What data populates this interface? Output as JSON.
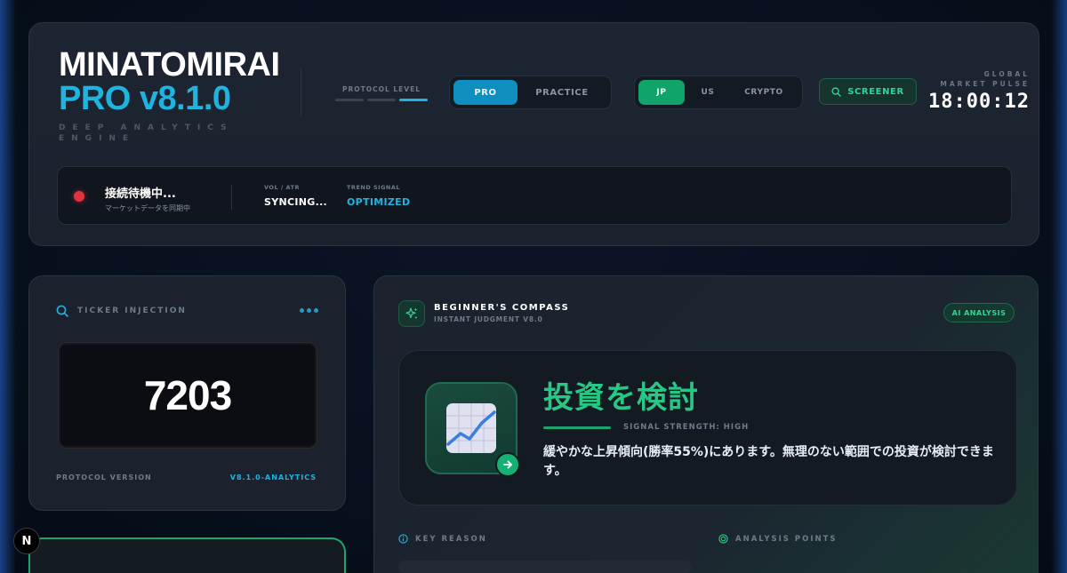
{
  "brand": {
    "title": "MINATOMIRAI",
    "version": "PRO v8.1.0",
    "subtitle": "DEEP ANALYTICS ENGINE"
  },
  "protocol_level": {
    "label": "PROTOCOL LEVEL",
    "level": 3,
    "max": 3
  },
  "mode_toggle": {
    "options": [
      "PRO",
      "PRACTICE"
    ],
    "selected": "PRO"
  },
  "market_toggle": {
    "options": [
      "JP",
      "US",
      "CRYPTO"
    ],
    "selected": "JP"
  },
  "screener": {
    "label": "SCREENER"
  },
  "pulse": {
    "label": "GLOBAL MARKET PULSE",
    "time": "18:00:12"
  },
  "status": {
    "title": "接続待機中...",
    "subtitle": "マーケットデータを同期中",
    "indicator_color": "#e0333d",
    "vol_label": "VOL / ATR",
    "vol_value": "SYNCING...",
    "trend_label": "TREND SIGNAL",
    "trend_value": "OPTIMIZED"
  },
  "ticker": {
    "label": "TICKER INJECTION",
    "value": "7203",
    "footer_label": "PROTOCOL VERSION",
    "footer_value": "V8.1.0-ANALYTICS"
  },
  "compass": {
    "title": "BEGINNER'S COMPASS",
    "subtitle": "INSTANT JUDGMENT V8.0",
    "badge": "AI ANALYSIS",
    "judgment": "投資を検討",
    "strength": "SIGNAL STRENGTH: HIGH",
    "description": "緩やかな上昇傾向(勝率55%)にあります。無理のない範囲での投資が検討できます。",
    "key_reason_label": "KEY REASON",
    "analysis_points_label": "ANALYSIS POINTS"
  },
  "colors": {
    "accent_blue": "#1fb3e0",
    "accent_green": "#27c885",
    "alert_red": "#e0333d"
  }
}
